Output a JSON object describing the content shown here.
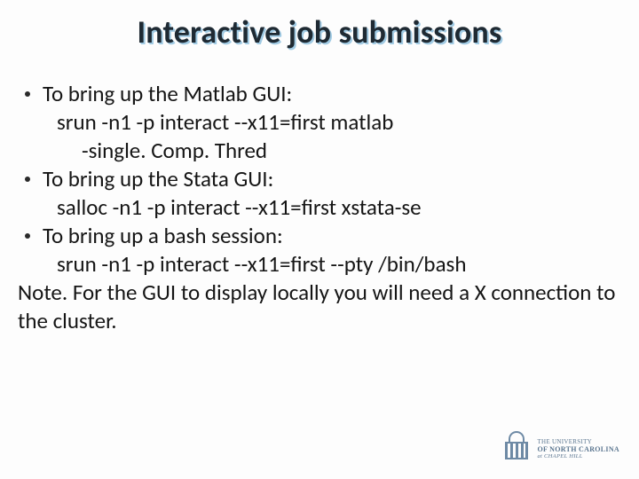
{
  "title": "Interactive job submissions",
  "bullets": [
    {
      "lead": "To bring up the Matlab GUI:",
      "line1": "srun -n1 -p interact --x11=first matlab",
      "line2": "-single. Comp. Thred"
    },
    {
      "lead": "To bring up the Stata GUI:",
      "line1": "salloc -n1 -p interact --x11=first xstata-se",
      "line2": ""
    },
    {
      "lead": "To bring up a bash session:",
      "line1": "srun -n1 -p interact --x11=first --pty /bin/bash",
      "line2": ""
    }
  ],
  "note": "Note. For the GUI to display locally you will need a X connection to the cluster.",
  "logo": {
    "l1": "THE UNIVERSITY",
    "l2": "of NORTH CAROLINA",
    "l3": "at CHAPEL HILL"
  }
}
